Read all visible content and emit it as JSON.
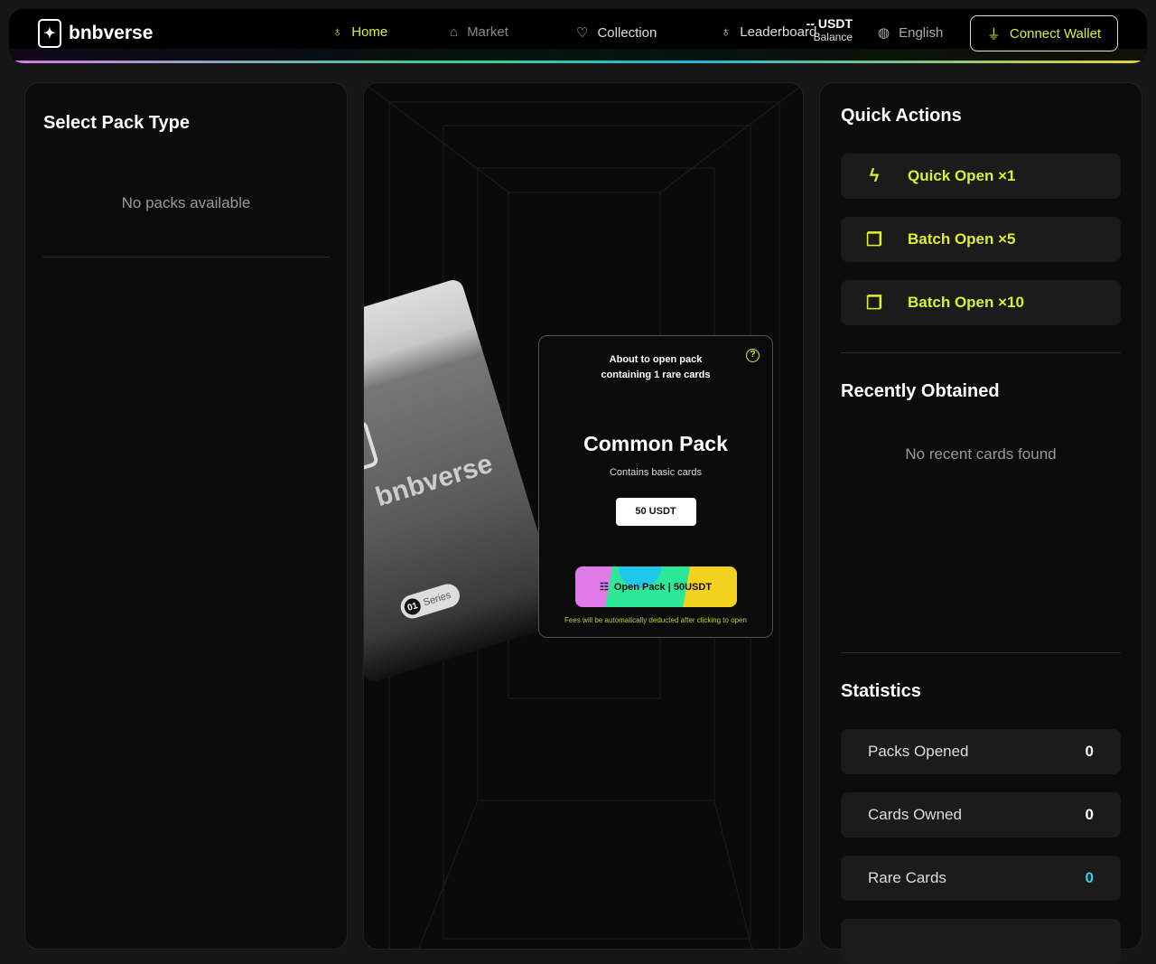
{
  "nav": {
    "brand": "bnbverse",
    "items": [
      {
        "label": "Home",
        "icon": "claw-icon"
      },
      {
        "label": "Market",
        "icon": "store-icon"
      },
      {
        "label": "Collection",
        "icon": "heart-icon"
      },
      {
        "label": "Leaderboard",
        "icon": "claw-icon"
      }
    ],
    "balance_value": "-- USDT",
    "balance_label": "Balance",
    "language": "English",
    "connect_wallet": "Connect Wallet"
  },
  "left": {
    "title": "Select Pack Type",
    "empty": "No packs available"
  },
  "pack_image": {
    "brand": "bnbverse",
    "series_num": "01",
    "series": "Series"
  },
  "card": {
    "about": "About to open pack",
    "about2": "containing 1 rare cards",
    "title": "Common Pack",
    "subtitle": "Contains basic cards",
    "price": "50 USDT",
    "open_label": "Open Pack | 50USDT",
    "fees": "Fees will be automatically deducted after clicking to open",
    "help": "?"
  },
  "right": {
    "quick_title": "Quick Actions",
    "actions": [
      {
        "label": "Quick Open ×1"
      },
      {
        "label": "Batch Open ×5"
      },
      {
        "label": "Batch Open ×10"
      }
    ],
    "recent_title": "Recently Obtained",
    "recent_empty": "No recent cards found",
    "stats_title": "Statistics",
    "stats": [
      {
        "label": "Packs Opened",
        "value": "0"
      },
      {
        "label": "Cards Owned",
        "value": "0"
      },
      {
        "label": "Rare Cards",
        "value": "0"
      }
    ]
  },
  "colors": {
    "accent": "#d8f02e",
    "rare": "#2fd0e8"
  }
}
